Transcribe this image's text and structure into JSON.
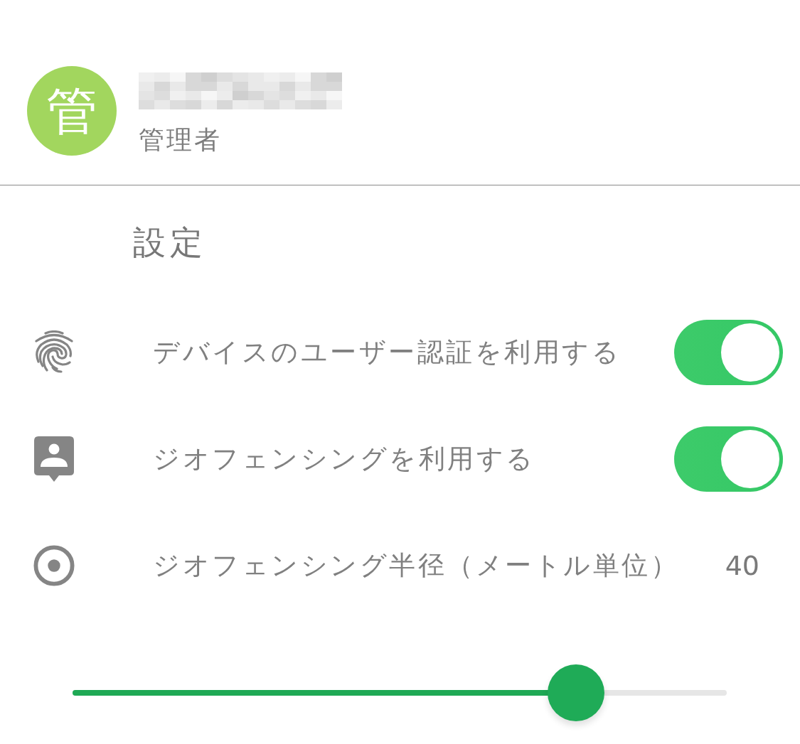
{
  "profile": {
    "avatar": "管",
    "role": "管理者"
  },
  "section": {
    "title": "設定"
  },
  "settings": [
    {
      "kind": "toggle",
      "label": "デバイスのユーザー認証を利用する",
      "on": true
    },
    {
      "kind": "toggle",
      "label": "ジオフェンシングを利用する",
      "on": true
    },
    {
      "kind": "value",
      "label": "ジオフェンシング半径（メートル単位）",
      "value": "40"
    }
  ],
  "slider": {
    "level": 0.77
  }
}
